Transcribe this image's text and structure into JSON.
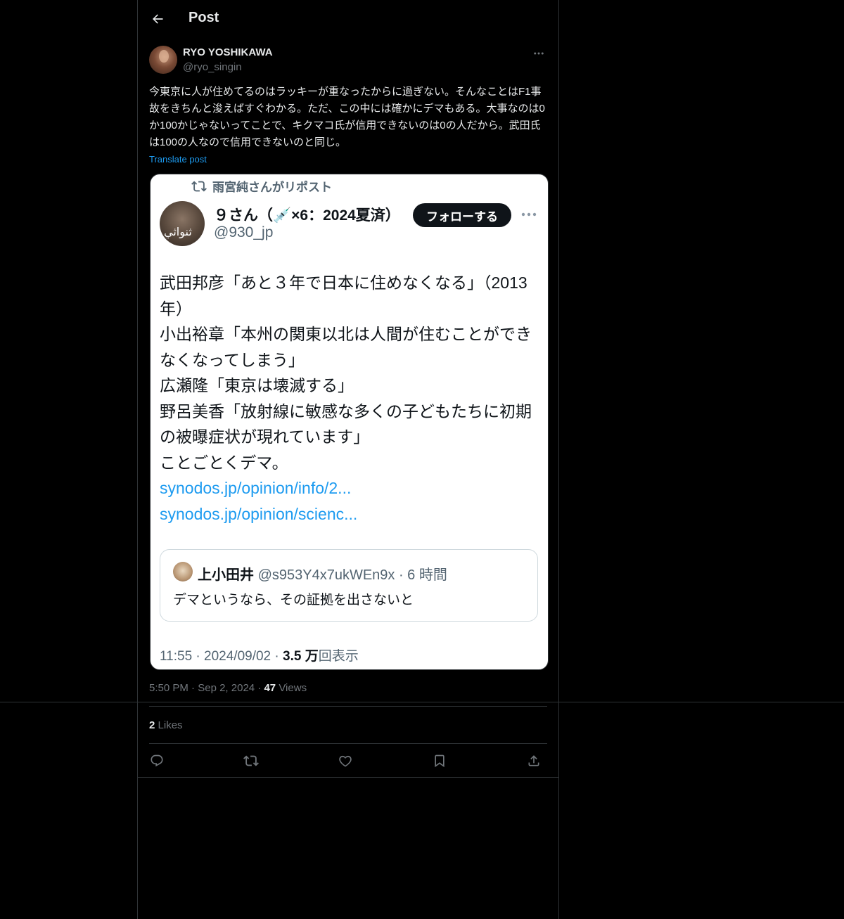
{
  "header": {
    "title": "Post"
  },
  "post": {
    "author_name": "RYO YOSHIKAWA",
    "author_handle": "@ryo_singin",
    "text": "今東京に人が住めてるのはラッキーが重なったからに過ぎない。そんなことはF1事故をきちんと浚えばすぐわかる。ただ、この中には確かにデマもある。大事なのは0か100かじゃないってことで、キクマコ氏が信用できないのは0の人だから。武田氏は100の人なので信用できないのと同じ。",
    "translate_label": "Translate post",
    "time": "5:50 PM",
    "date": "Sep 2, 2024",
    "views_count": "47",
    "views_label": "Views",
    "likes_count": "2",
    "likes_label": "Likes"
  },
  "image": {
    "repost_label": "雨宮純さんがリポスト",
    "author_name": "９さん（💉×6：2024夏済）",
    "author_handle": "@930_jp",
    "avatar_overlay": "ثنواثي",
    "follow_label": "フォローする",
    "body_lines": [
      "武田邦彦「あと３年で日本に住めなくなる」（2013",
      "年）",
      "小出裕章「本州の関東以北は人間が住むことができ",
      "なくなってしまう」",
      "広瀬隆「東京は壊滅する」",
      "野呂美香「放射線に敏感な多くの子どもたちに初期",
      "の被曝症状が現れています」",
      "ことごとくデマ。"
    ],
    "links": [
      "synodos.jp/opinion/info/2...",
      "synodos.jp/opinion/scienc..."
    ],
    "nested": {
      "name": "上小田井",
      "meta": "@s953Y4x7ukWEn9x · 6 時間",
      "text": "デマというなら、その証拠を出さないと"
    },
    "time_text": "11:55 · 2024/09/02 · ",
    "views_count": "3.5 万",
    "views_label": "回表示"
  },
  "icons": {
    "back": "arrow-left-icon",
    "more": "more-horizontal-icon",
    "reply": "reply-icon",
    "repost": "repost-icon",
    "like": "heart-icon",
    "bookmark": "bookmark-icon",
    "share": "share-icon"
  },
  "colors": {
    "background": "#000000",
    "text": "#e7e9ea",
    "secondary": "#71767b",
    "link": "#1d9bf0",
    "border": "#2f3336"
  }
}
